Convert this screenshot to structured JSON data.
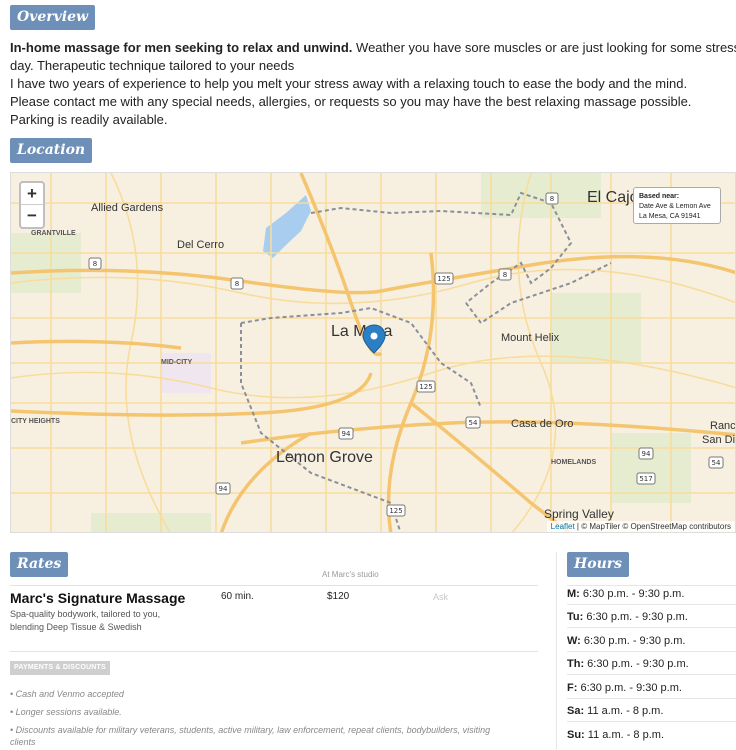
{
  "overview": {
    "tag": "Overview",
    "bold_lead": "In-home massage for men seeking to relax and unwind.",
    "line1_rest": " Weather you have sore muscles or are just looking for some stress relief from the",
    "line2": "day. Therapeutic technique tailored to your needs",
    "line3": "I have two years of experience to help you melt your stress away with a relaxing touch to ease the body and the mind.",
    "line4": "Please contact me with any special needs, allergies, or requests so you may have the best relaxing massage possible.",
    "line5": "Parking is readily available."
  },
  "location": {
    "tag": "Location",
    "zoom_in": "+",
    "zoom_out": "−",
    "info_title": "Based near:",
    "info_line1": "Date Ave & Lemon Ave",
    "info_line2": "La Mesa, CA 91941",
    "attribution_leaflet": "Leaflet",
    "attribution_rest": " | © MapTiler © OpenStreetMap contributors",
    "places": {
      "allied_gardens": "Allied Gardens",
      "del_cerro": "Del Cerro",
      "grantville": "GRANTVILLE",
      "el_cajon": "El Cajo",
      "la_mesa": "La Mesa",
      "mount_helix": "Mount Helix",
      "mid_city": "MID-CITY",
      "city_heights": "CITY HEIGHTS",
      "lemon_grove": "Lemon Grove",
      "casa_de_oro": "Casa de Oro",
      "homelands": "HOMELANDS",
      "spring_valley": "Spring Valley",
      "rancho": "Ranc",
      "san_diego": "San Di"
    },
    "shields": {
      "s8a": "8",
      "s8b": "8",
      "s8c": "8",
      "s8d": "8",
      "s125a": "125",
      "s125b": "125",
      "s125c": "125",
      "s94a": "94",
      "s94b": "94",
      "s94c": "94",
      "s54": "54",
      "s517": "517"
    }
  },
  "rates": {
    "tag": "Rates",
    "column_header": "At Marc's studio",
    "name": "Marc's Signature Massage",
    "description": "Spa-quality bodywork, tailored to you, blending Deep Tissue & Swedish",
    "duration": "60 min.",
    "price": "$120",
    "ask": "Ask",
    "payments_label": "PAYMENTS & DISCOUNTS",
    "payments": [
      "• Cash and Venmo accepted",
      "• Longer sessions available.",
      "• Discounts available for military veterans, students, active military, law enforcement, repeat clients, bodybuilders, visiting clients"
    ]
  },
  "hours": {
    "tag": "Hours",
    "days": [
      {
        "day": "M:",
        "time": " 6:30 p.m. - 9:30 p.m."
      },
      {
        "day": "Tu:",
        "time": " 6:30 p.m. - 9:30 p.m."
      },
      {
        "day": "W:",
        "time": " 6:30 p.m. - 9:30 p.m."
      },
      {
        "day": "Th:",
        "time": " 6:30 p.m. - 9:30 p.m."
      },
      {
        "day": "F:",
        "time": " 6:30 p.m. - 9:30 p.m."
      },
      {
        "day": "Sa:",
        "time": " 11 a.m. - 8 p.m."
      },
      {
        "day": "Su:",
        "time": " 11 a.m. - 8 p.m."
      }
    ]
  },
  "colors": {
    "tag_bg": "#6d8fb8",
    "map_land": "#f7f0e1",
    "map_road": "#f7d58a",
    "map_highway": "#f5c36b",
    "map_water": "#9cc3e6",
    "map_park": "#dfe8c4",
    "marker": "#2b7fc4"
  }
}
